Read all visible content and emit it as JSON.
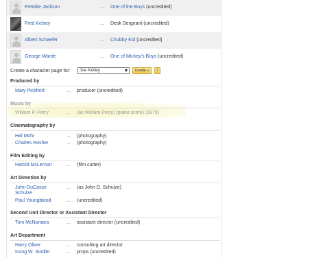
{
  "cast": [
    {
      "actor": "Freddie Jackson",
      "dots": "...",
      "character_link": "One of the Boys",
      "character_note": "(uncredited)"
    },
    {
      "actor": "Fred Kelsey",
      "dots": "...",
      "character_text": "Desk Sergeant (uncredited)"
    },
    {
      "actor": "Albert Schaefer",
      "dots": "...",
      "character_link": "Chubby Kid",
      "character_note": "(uncredited)"
    },
    {
      "actor": "George Warde",
      "dots": "...",
      "character_link": "One of Mickey's Boys",
      "character_note": "(uncredited)"
    }
  ],
  "character_page": {
    "label": "Create a character page for:",
    "selected": "Joe Kelley",
    "create_button": "Create »",
    "help_button": "?"
  },
  "sections": {
    "produced_by": {
      "title": "Produced by",
      "rows": [
        {
          "name": "Mary Pickford",
          "dots": "...",
          "credit": "producer (uncredited)"
        }
      ]
    },
    "music_by": {
      "title": "Music by",
      "rows": [
        {
          "name": "William P. Perry",
          "dots": "...",
          "credit": "(as William Perry) (piano score) (1976)"
        }
      ]
    },
    "cinematography_by": {
      "title": "Cinematography by",
      "rows": [
        {
          "name": "Hal Mohr",
          "dots": "...",
          "credit": "(photography)"
        },
        {
          "name": "Charles Rosher",
          "dots": "...",
          "credit": "(photography)"
        }
      ]
    },
    "film_editing_by": {
      "title": "Film Editing by",
      "rows": [
        {
          "name": "Harold McLernon",
          "dots": "...",
          "credit": "(film cutter)"
        }
      ]
    },
    "art_direction_by": {
      "title": "Art Direction by",
      "rows": [
        {
          "name_line1": "John DuCasse",
          "name_line2": "Schulze",
          "dots": "...",
          "credit": "(as John D. Schulze)"
        },
        {
          "name": "Paul Youngblood",
          "dots": "...",
          "credit": "(uncredited)"
        }
      ]
    },
    "second_unit": {
      "title": "Second Unit Director or Assistant Director",
      "rows": [
        {
          "name": "Tom McNamara",
          "dots": "...",
          "credit": "assistant director (uncredited)"
        }
      ]
    },
    "art_department": {
      "title": "Art Department",
      "rows": [
        {
          "name": "Harry Oliver",
          "dots": "...",
          "credit": "consulting art director"
        },
        {
          "name": "Irving W. Sindler",
          "dots": "...",
          "credit": "props (uncredited)"
        }
      ]
    }
  }
}
